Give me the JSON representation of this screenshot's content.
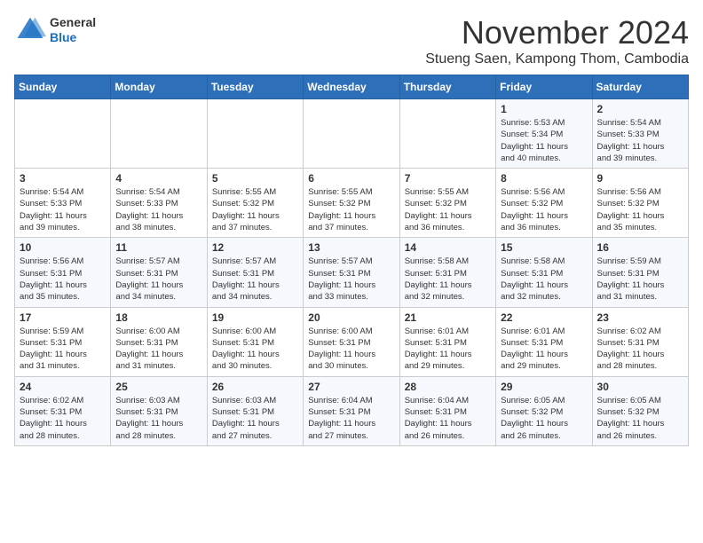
{
  "header": {
    "logo": {
      "general": "General",
      "blue": "Blue"
    },
    "title": "November 2024",
    "location": "Stueng Saen, Kampong Thom, Cambodia"
  },
  "weekdays": [
    "Sunday",
    "Monday",
    "Tuesday",
    "Wednesday",
    "Thursday",
    "Friday",
    "Saturday"
  ],
  "weeks": [
    [
      {
        "day": "",
        "info": ""
      },
      {
        "day": "",
        "info": ""
      },
      {
        "day": "",
        "info": ""
      },
      {
        "day": "",
        "info": ""
      },
      {
        "day": "",
        "info": ""
      },
      {
        "day": "1",
        "info": "Sunrise: 5:53 AM\nSunset: 5:34 PM\nDaylight: 11 hours\nand 40 minutes."
      },
      {
        "day": "2",
        "info": "Sunrise: 5:54 AM\nSunset: 5:33 PM\nDaylight: 11 hours\nand 39 minutes."
      }
    ],
    [
      {
        "day": "3",
        "info": "Sunrise: 5:54 AM\nSunset: 5:33 PM\nDaylight: 11 hours\nand 39 minutes."
      },
      {
        "day": "4",
        "info": "Sunrise: 5:54 AM\nSunset: 5:33 PM\nDaylight: 11 hours\nand 38 minutes."
      },
      {
        "day": "5",
        "info": "Sunrise: 5:55 AM\nSunset: 5:32 PM\nDaylight: 11 hours\nand 37 minutes."
      },
      {
        "day": "6",
        "info": "Sunrise: 5:55 AM\nSunset: 5:32 PM\nDaylight: 11 hours\nand 37 minutes."
      },
      {
        "day": "7",
        "info": "Sunrise: 5:55 AM\nSunset: 5:32 PM\nDaylight: 11 hours\nand 36 minutes."
      },
      {
        "day": "8",
        "info": "Sunrise: 5:56 AM\nSunset: 5:32 PM\nDaylight: 11 hours\nand 36 minutes."
      },
      {
        "day": "9",
        "info": "Sunrise: 5:56 AM\nSunset: 5:32 PM\nDaylight: 11 hours\nand 35 minutes."
      }
    ],
    [
      {
        "day": "10",
        "info": "Sunrise: 5:56 AM\nSunset: 5:31 PM\nDaylight: 11 hours\nand 35 minutes."
      },
      {
        "day": "11",
        "info": "Sunrise: 5:57 AM\nSunset: 5:31 PM\nDaylight: 11 hours\nand 34 minutes."
      },
      {
        "day": "12",
        "info": "Sunrise: 5:57 AM\nSunset: 5:31 PM\nDaylight: 11 hours\nand 34 minutes."
      },
      {
        "day": "13",
        "info": "Sunrise: 5:57 AM\nSunset: 5:31 PM\nDaylight: 11 hours\nand 33 minutes."
      },
      {
        "day": "14",
        "info": "Sunrise: 5:58 AM\nSunset: 5:31 PM\nDaylight: 11 hours\nand 32 minutes."
      },
      {
        "day": "15",
        "info": "Sunrise: 5:58 AM\nSunset: 5:31 PM\nDaylight: 11 hours\nand 32 minutes."
      },
      {
        "day": "16",
        "info": "Sunrise: 5:59 AM\nSunset: 5:31 PM\nDaylight: 11 hours\nand 31 minutes."
      }
    ],
    [
      {
        "day": "17",
        "info": "Sunrise: 5:59 AM\nSunset: 5:31 PM\nDaylight: 11 hours\nand 31 minutes."
      },
      {
        "day": "18",
        "info": "Sunrise: 6:00 AM\nSunset: 5:31 PM\nDaylight: 11 hours\nand 31 minutes."
      },
      {
        "day": "19",
        "info": "Sunrise: 6:00 AM\nSunset: 5:31 PM\nDaylight: 11 hours\nand 30 minutes."
      },
      {
        "day": "20",
        "info": "Sunrise: 6:00 AM\nSunset: 5:31 PM\nDaylight: 11 hours\nand 30 minutes."
      },
      {
        "day": "21",
        "info": "Sunrise: 6:01 AM\nSunset: 5:31 PM\nDaylight: 11 hours\nand 29 minutes."
      },
      {
        "day": "22",
        "info": "Sunrise: 6:01 AM\nSunset: 5:31 PM\nDaylight: 11 hours\nand 29 minutes."
      },
      {
        "day": "23",
        "info": "Sunrise: 6:02 AM\nSunset: 5:31 PM\nDaylight: 11 hours\nand 28 minutes."
      }
    ],
    [
      {
        "day": "24",
        "info": "Sunrise: 6:02 AM\nSunset: 5:31 PM\nDaylight: 11 hours\nand 28 minutes."
      },
      {
        "day": "25",
        "info": "Sunrise: 6:03 AM\nSunset: 5:31 PM\nDaylight: 11 hours\nand 28 minutes."
      },
      {
        "day": "26",
        "info": "Sunrise: 6:03 AM\nSunset: 5:31 PM\nDaylight: 11 hours\nand 27 minutes."
      },
      {
        "day": "27",
        "info": "Sunrise: 6:04 AM\nSunset: 5:31 PM\nDaylight: 11 hours\nand 27 minutes."
      },
      {
        "day": "28",
        "info": "Sunrise: 6:04 AM\nSunset: 5:31 PM\nDaylight: 11 hours\nand 26 minutes."
      },
      {
        "day": "29",
        "info": "Sunrise: 6:05 AM\nSunset: 5:32 PM\nDaylight: 11 hours\nand 26 minutes."
      },
      {
        "day": "30",
        "info": "Sunrise: 6:05 AM\nSunset: 5:32 PM\nDaylight: 11 hours\nand 26 minutes."
      }
    ]
  ]
}
